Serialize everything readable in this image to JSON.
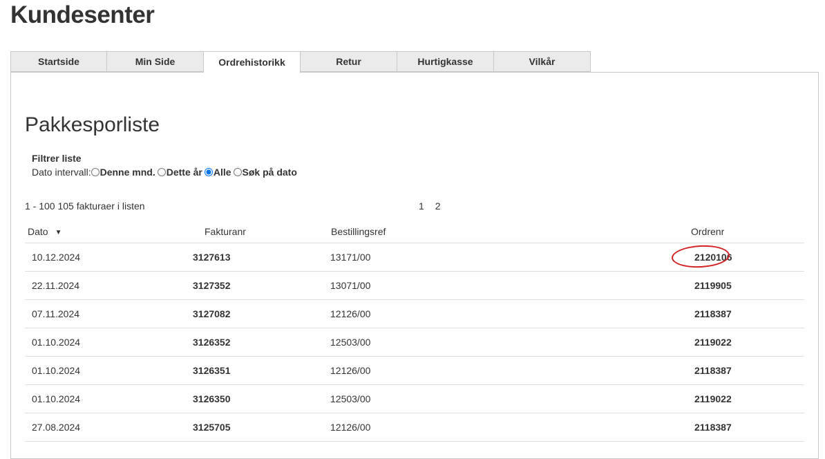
{
  "header": {
    "title": "Kundesenter"
  },
  "tabs": [
    {
      "label": "Startside"
    },
    {
      "label": "Min Side"
    },
    {
      "label": "Ordrehistorikk"
    },
    {
      "label": "Retur"
    },
    {
      "label": "Hurtigkasse"
    },
    {
      "label": "Vilkår"
    }
  ],
  "active_tab": "Ordrehistorikk",
  "main": {
    "title": "Pakkesporliste",
    "filter": {
      "heading": "Filtrer liste",
      "label": "Dato intervall:",
      "options": [
        {
          "label": "Denne mnd.",
          "checked": false
        },
        {
          "label": "Dette år",
          "checked": false
        },
        {
          "label": "Alle",
          "checked": true
        },
        {
          "label": "Søk på dato",
          "checked": false
        }
      ]
    },
    "count_text": "1 - 100 105 fakturaer i listen",
    "pages": [
      "1",
      "2"
    ],
    "table": {
      "columns": [
        "Dato",
        "Fakturanr",
        "Bestillingsref",
        "Ordrenr"
      ],
      "rows": [
        [
          "10.12.2024",
          "3127613",
          "13171/00",
          "2120106"
        ],
        [
          "22.11.2024",
          "3127352",
          "13071/00",
          "2119905"
        ],
        [
          "07.11.2024",
          "3127082",
          "12126/00",
          "2118387"
        ],
        [
          "01.10.2024",
          "3126352",
          "12503/00",
          "2119022"
        ],
        [
          "01.10.2024",
          "3126351",
          "12126/00",
          "2118387"
        ],
        [
          "01.10.2024",
          "3126350",
          "12503/00",
          "2119022"
        ],
        [
          "27.08.2024",
          "3125705",
          "12126/00",
          "2118387"
        ]
      ]
    }
  },
  "colors": {
    "annotation": "#d42020",
    "tab_bg": "#ebebeb",
    "border": "#c8c8c8"
  },
  "icons": {
    "sort": "caret-down-icon"
  }
}
